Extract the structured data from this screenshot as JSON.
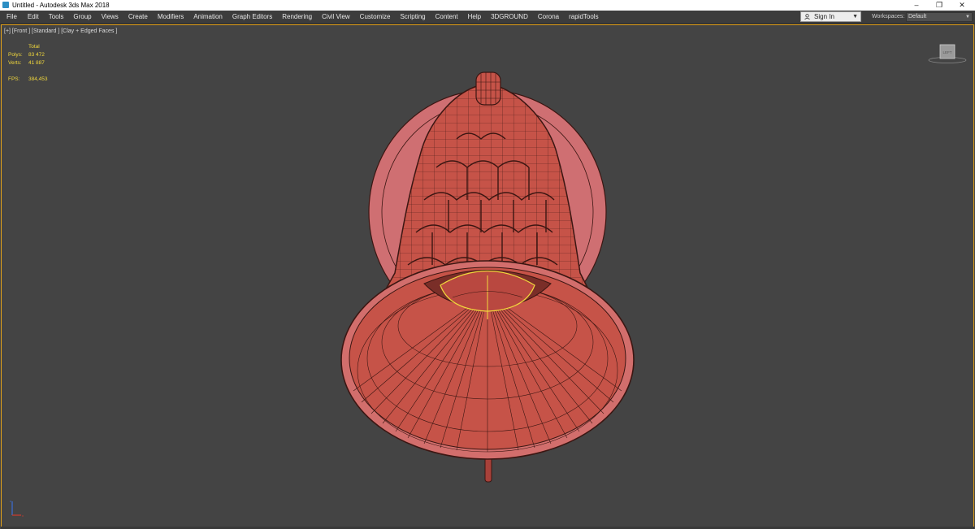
{
  "window": {
    "title": "Untitled - Autodesk 3ds Max 2018",
    "minimize": "–",
    "restore": "❐",
    "close": "✕"
  },
  "menu": [
    "File",
    "Edit",
    "Tools",
    "Group",
    "Views",
    "Create",
    "Modifiers",
    "Animation",
    "Graph Editors",
    "Rendering",
    "Civil View",
    "Customize",
    "Scripting",
    "Content",
    "Help",
    "3DGROUND",
    "Corona",
    "rapidTools"
  ],
  "signin": {
    "label": "Sign In"
  },
  "workspaces": {
    "label": "Workspaces:",
    "value": "Default"
  },
  "viewport": {
    "label": "[+] [Front ] [Standard ] [Clay + Edged Faces ]",
    "stats": {
      "header": "Total",
      "polys_label": "Polys:",
      "polys_value": "83 472",
      "verts_label": "Verts:",
      "verts_value": "41 887",
      "fps_label": "FPS:",
      "fps_value": "384,453"
    },
    "viewcube_label": "LEFT"
  },
  "colors": {
    "viewport_bg": "#444444",
    "active_border": "#e3a21a",
    "stats_text": "#f2d83c",
    "mesh_fill": "#c65348",
    "mesh_wire": "#3b1612",
    "rim_fill": "#cf6f72"
  },
  "icons": {
    "app": "3dsmax-app-icon",
    "user": "user-icon",
    "dropdown": "chevron-down-icon"
  }
}
